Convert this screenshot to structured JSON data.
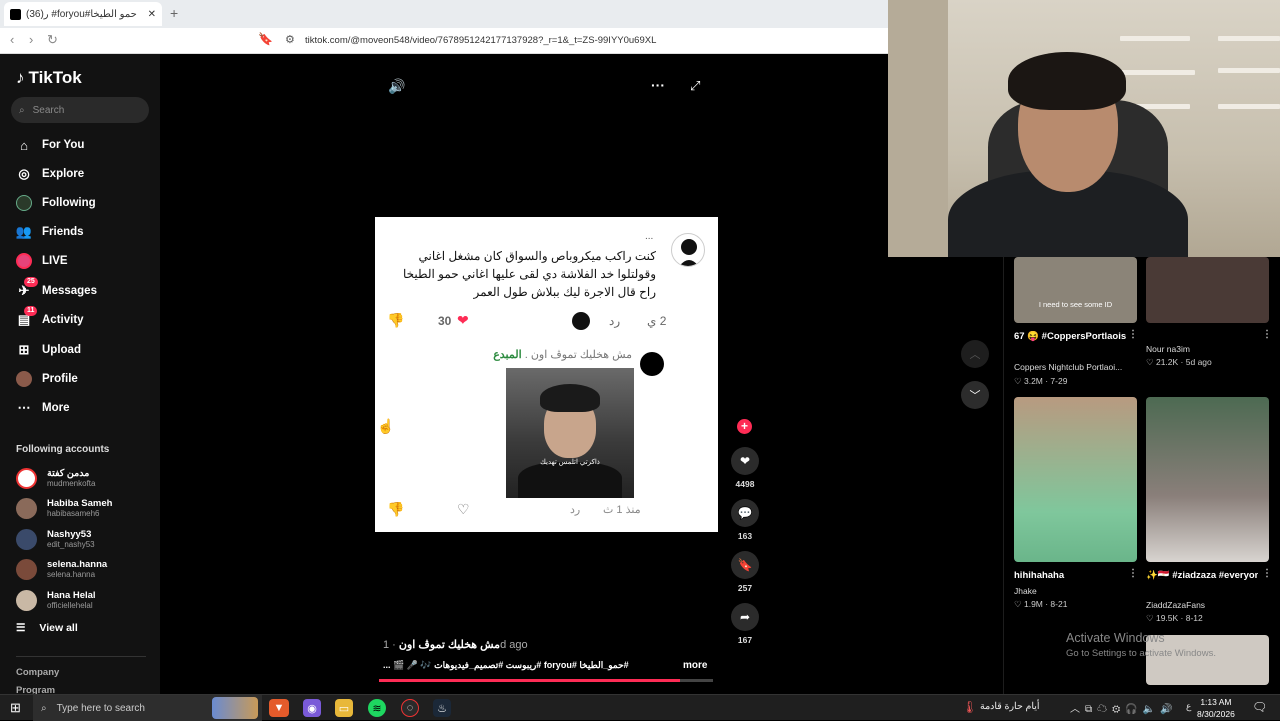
{
  "browser": {
    "tab_title": "حمو الطيخا#foryou# ر(36)",
    "new_tab_symbol": "+",
    "url": "tiktok.com/@moveon548/video/7678951242177137928?_r=1&_t=ZS-99IYY0u69XL"
  },
  "sidebar": {
    "logo": "TikTok",
    "search_placeholder": "Search",
    "nav": [
      {
        "label": "For You",
        "icon": "home-icon"
      },
      {
        "label": "Explore",
        "icon": "compass-icon"
      },
      {
        "label": "Following",
        "icon": "following-icon"
      },
      {
        "label": "Friends",
        "icon": "friends-icon"
      },
      {
        "label": "LIVE",
        "icon": "live-icon"
      },
      {
        "label": "Messages",
        "icon": "messages-icon",
        "badge": "25"
      },
      {
        "label": "Activity",
        "icon": "activity-icon",
        "badge": "11"
      },
      {
        "label": "Upload",
        "icon": "upload-icon"
      },
      {
        "label": "Profile",
        "icon": "profile-icon"
      },
      {
        "label": "More",
        "icon": "more-icon"
      }
    ],
    "following_heading": "Following accounts",
    "accounts": [
      {
        "name": "مدمن كفتة",
        "handle": "mudmenkofta",
        "color": "#ffffff"
      },
      {
        "name": "Habiba Sameh",
        "handle": "habibasameh6",
        "color": "#8a6a5a"
      },
      {
        "name": "Nashyy53",
        "handle": "edit_nashy53",
        "color": "#3a4a6a"
      },
      {
        "name": "selena.hanna",
        "handle": "selena.hanna",
        "color": "#7a4a3a"
      },
      {
        "name": "Hana Helal",
        "handle": "officiellehelal",
        "color": "#c9b8a5"
      }
    ],
    "view_all": "View all",
    "company": "Company",
    "program": "Program"
  },
  "video": {
    "comment_text": "كنت راكب ميكروباص والسواق كان مشغل اغاني وقولتلوا خد الفلاشة دي لقى عليها اغاني حمو الطيخا راح قال الاجرة ليك ببلاش طول العمر",
    "card_menu": "...",
    "like_count": "30",
    "reply_label": "رد",
    "comment_age": "2 ي",
    "reply_text": "مش هخليك تموڤ اون .",
    "reply_author": "المبدع",
    "thumb_caption": "ذاكرتي اتلمس تهديك",
    "reply_age": "منذ 1 ث",
    "reply_reply": "رد",
    "title": "مش هخليك تموڤ اون",
    "age": " · 1d ago",
    "tags": "#حمو_الطيخا #foryou #ريبوست #تصميم_فيديوهات 🎶 🎤 🎬 ...",
    "more": "more",
    "progress": 0.9
  },
  "actions": {
    "likes": "4498",
    "comments": "163",
    "saves": "257",
    "shares": "167"
  },
  "grid": [
    {
      "title": "67 😝 #CoppersPortlaoise...",
      "sub": "Coppers Nightclub Portlaoi...",
      "stats": "♡ 3.2M · 7-29",
      "overlay": "I need to see some ID",
      "bg": "#8b8478"
    },
    {
      "title": "",
      "sub": "Nour na3im",
      "stats": "♡ 21.2K · 5d ago",
      "overlay": "",
      "bg": "#4a3a36"
    },
    {
      "title": "hihihahaha",
      "sub": "Jhake",
      "stats": "♡ 1.9M · 8-21",
      "overlay": "",
      "bg": "#6ab58a"
    },
    {
      "title": "✨🇪🇬 #ziadzaza #everyone🪄",
      "sub": "ZiaddZazaFans",
      "stats": "♡ 19.5K · 8-12",
      "overlay": "",
      "bg": "#3f5a4a"
    }
  ],
  "windows_notice": {
    "title": "Activate Windows",
    "sub": "Go to Settings to activate Windows."
  },
  "taskbar": {
    "search_placeholder": "Type here to search",
    "weather": "أيام حارة قادمة",
    "lang": "ع",
    "time": "1:13 AM",
    "date": "8/30/2026"
  },
  "colors": {
    "accent": "#fe2c55",
    "bg": "#000000",
    "sidebar": "#121212"
  }
}
